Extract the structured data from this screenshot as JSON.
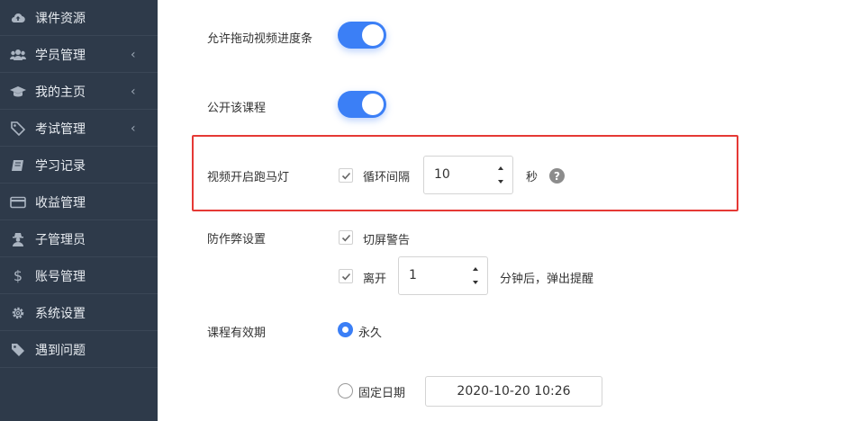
{
  "sidebar": {
    "items": [
      {
        "label": "课件资源",
        "icon": "cloud-upload-icon",
        "chevron": ""
      },
      {
        "label": "学员管理",
        "icon": "users-icon",
        "chevron": "‹"
      },
      {
        "label": "我的主页",
        "icon": "graduation-cap-icon",
        "chevron": "‹"
      },
      {
        "label": "考试管理",
        "icon": "tag-icon",
        "chevron": "‹"
      },
      {
        "label": "学习记录",
        "icon": "book-icon",
        "chevron": ""
      },
      {
        "label": "收益管理",
        "icon": "credit-card-icon",
        "chevron": ""
      },
      {
        "label": "子管理员",
        "icon": "user-secret-icon",
        "chevron": ""
      },
      {
        "label": "账号管理",
        "icon": "dollar-icon",
        "chevron": ""
      },
      {
        "label": "系统设置",
        "icon": "gear-icon",
        "chevron": ""
      },
      {
        "label": "遇到问题",
        "icon": "tags-icon",
        "chevron": ""
      }
    ]
  },
  "settings": {
    "drag_progress": {
      "label": "允许拖动视频进度条",
      "enabled": true
    },
    "public_course": {
      "label": "公开该课程",
      "enabled": true
    },
    "marquee": {
      "label": "视频开启跑马灯",
      "loop_label": "循环间隔",
      "loop_checked": true,
      "interval_value": "10",
      "unit": "秒",
      "help": "?"
    },
    "anti_cheat": {
      "label": "防作弊设置",
      "switch_warning_label": "切屏警告",
      "switch_warning_checked": true,
      "leave_label": "离开",
      "leave_checked": true,
      "leave_minutes": "1",
      "leave_suffix": "分钟后，弹出提醒"
    },
    "validity": {
      "label": "课程有效期",
      "permanent_label": "永久",
      "fixed_label": "固定日期",
      "selected": "permanent",
      "fixed_date_value": "2020-10-20 10:26"
    }
  },
  "colors": {
    "accent": "#3b7ff6",
    "sidebar_bg": "#2e3a4a",
    "highlight": "#e53935"
  }
}
